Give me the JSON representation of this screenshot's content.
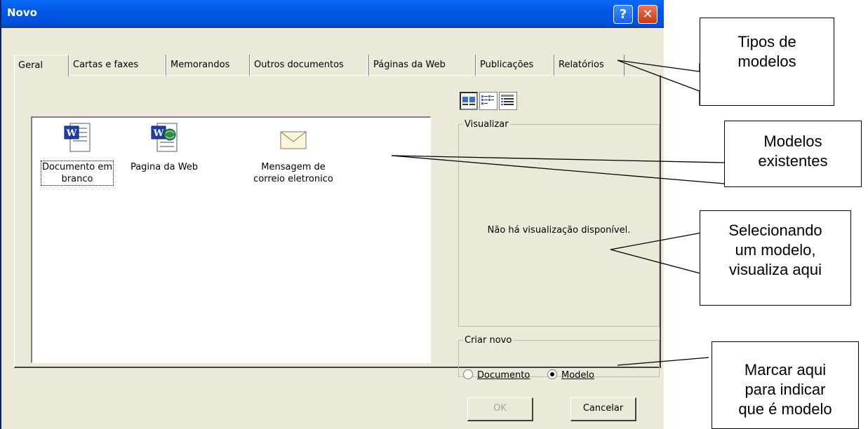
{
  "window": {
    "title": "Novo",
    "help_glyph": "?",
    "close_glyph": "✕"
  },
  "tabs": [
    "Geral",
    "Cartas e faxes",
    "Memorandos",
    "Outros documentos",
    "Páginas da Web",
    "Publicações",
    "Relatórios"
  ],
  "templates": [
    {
      "label_line1": "Documento em",
      "label_line2": "branco",
      "icon": "word-document-icon"
    },
    {
      "label_line1": "Pagina da Web",
      "label_line2": "",
      "icon": "word-web-page-icon"
    },
    {
      "label_line1": "Mensagem de",
      "label_line2": "correio eletronico",
      "icon": "envelope-icon"
    }
  ],
  "view_buttons": [
    "large-icons",
    "list",
    "details"
  ],
  "preview": {
    "legend": "Visualizar",
    "message": "Não há visualização disponível."
  },
  "create_new": {
    "legend": "Criar novo",
    "option_document": "Documento",
    "option_template": "Modelo",
    "selected": "Modelo"
  },
  "buttons": {
    "ok": "OK",
    "cancel": "Cancelar"
  },
  "callouts": {
    "types": [
      "Tipos de",
      "modelos"
    ],
    "existing": [
      "Modelos",
      "existentes"
    ],
    "preview": [
      "Selecionando",
      "um modelo,",
      "visualiza aqui"
    ],
    "mark": [
      "Marcar aqui",
      "para indicar",
      "que é modelo"
    ]
  },
  "colors": {
    "titlebar": "#0058e6",
    "dialog_bg": "#ece9d8",
    "close": "#c53a15"
  }
}
